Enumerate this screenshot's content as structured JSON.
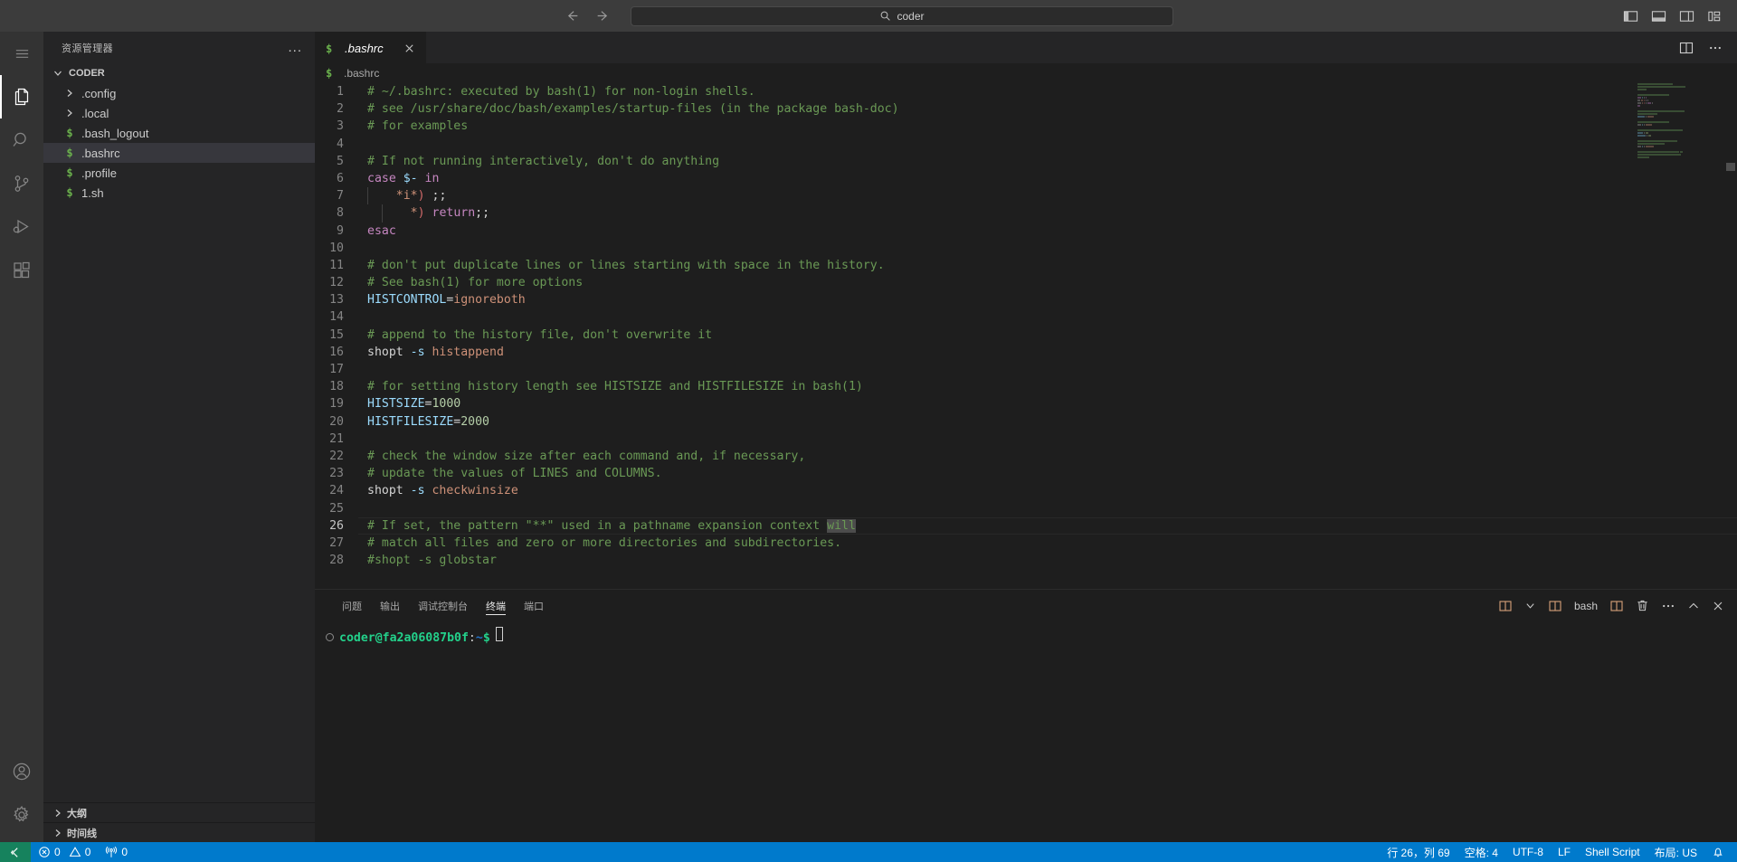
{
  "titlebar": {
    "back_icon": "arrow-left-icon",
    "forward_icon": "arrow-right-icon",
    "search": {
      "value": "coder",
      "placeholder": "",
      "icon": "search-icon"
    },
    "layout_icons": [
      "toggle-primary-sidebar-icon",
      "toggle-panel-icon",
      "toggle-secondary-sidebar-icon",
      "customize-layout-icon"
    ]
  },
  "activitybar": {
    "menu_icon": "hamburger-menu-icon",
    "items": [
      {
        "name": "explorer",
        "icon": "files-icon",
        "active": true
      },
      {
        "name": "search",
        "icon": "search-icon",
        "active": false
      },
      {
        "name": "source-control",
        "icon": "source-control-icon",
        "active": false
      },
      {
        "name": "run-and-debug",
        "icon": "run-debug-icon",
        "active": false
      },
      {
        "name": "extensions",
        "icon": "extensions-icon",
        "active": false
      }
    ],
    "bottom_items": [
      {
        "name": "accounts",
        "icon": "account-icon"
      },
      {
        "name": "manage",
        "icon": "gear-icon"
      }
    ]
  },
  "sidebar": {
    "title": "资源管理器",
    "more_actions": "...",
    "root_folder": "CODER",
    "tree": [
      {
        "label": ".config",
        "type": "folder",
        "icon": "chevron-right-icon",
        "selected": false
      },
      {
        "label": ".local",
        "type": "folder",
        "icon": "chevron-right-icon",
        "selected": false
      },
      {
        "label": ".bash_logout",
        "type": "file",
        "icon": "shell-file-icon",
        "selected": false
      },
      {
        "label": ".bashrc",
        "type": "file",
        "icon": "shell-file-icon",
        "selected": true
      },
      {
        "label": ".profile",
        "type": "file",
        "icon": "shell-file-icon",
        "selected": false
      },
      {
        "label": "1.sh",
        "type": "file",
        "icon": "shell-file-icon",
        "selected": false
      }
    ],
    "bottom_sections": [
      {
        "label": "大纲",
        "icon": "chevron-right-icon"
      },
      {
        "label": "时间线",
        "icon": "chevron-right-icon"
      }
    ]
  },
  "editor": {
    "tab": {
      "label": ".bashrc",
      "icon": "shell-file-icon",
      "close_icon": "close-icon",
      "dirty": false,
      "preview": true
    },
    "actions": [
      "split-editor-icon",
      "more-actions-icon"
    ],
    "breadcrumb": {
      "label": ".bashrc",
      "icon": "shell-file-icon"
    },
    "lines": [
      {
        "n": "1",
        "segs": [
          {
            "t": "# ~/.bashrc: executed by bash(1) for non-login shells.",
            "c": "cm"
          }
        ]
      },
      {
        "n": "2",
        "segs": [
          {
            "t": "# see /usr/share/doc/bash/examples/startup-files (in the package bash-doc)",
            "c": "cm"
          }
        ]
      },
      {
        "n": "3",
        "segs": [
          {
            "t": "# for examples",
            "c": "cm"
          }
        ]
      },
      {
        "n": "4",
        "segs": []
      },
      {
        "n": "5",
        "segs": [
          {
            "t": "# If not running interactively, don't do anything",
            "c": "cm"
          }
        ]
      },
      {
        "n": "6",
        "segs": [
          {
            "t": "case ",
            "c": "kw"
          },
          {
            "t": "$-",
            "c": "var"
          },
          {
            "t": " ",
            "c": "op"
          },
          {
            "t": "in",
            "c": "kw"
          }
        ]
      },
      {
        "n": "7",
        "segs": [
          {
            "t": "    ",
            "c": "op"
          },
          {
            "t": "*i*",
            "c": "pat"
          },
          {
            "t": ")",
            "c": "red"
          },
          {
            "t": " ",
            "c": "op"
          },
          {
            "t": ";;",
            "c": "op"
          }
        ]
      },
      {
        "n": "8",
        "segs": [
          {
            "t": "      ",
            "c": "op"
          },
          {
            "t": "*",
            "c": "pat"
          },
          {
            "t": ")",
            "c": "red"
          },
          {
            "t": " ",
            "c": "op"
          },
          {
            "t": "return",
            "c": "kw"
          },
          {
            "t": ";;",
            "c": "op"
          }
        ]
      },
      {
        "n": "9",
        "segs": [
          {
            "t": "esac",
            "c": "kw"
          }
        ]
      },
      {
        "n": "10",
        "segs": []
      },
      {
        "n": "11",
        "segs": [
          {
            "t": "# don't put duplicate lines or lines starting with space in the history.",
            "c": "cm"
          }
        ]
      },
      {
        "n": "12",
        "segs": [
          {
            "t": "# See bash(1) for more options",
            "c": "cm"
          }
        ]
      },
      {
        "n": "13",
        "segs": [
          {
            "t": "HISTCONTROL",
            "c": "var"
          },
          {
            "t": "=",
            "c": "op"
          },
          {
            "t": "ignoreboth",
            "c": "str"
          }
        ]
      },
      {
        "n": "14",
        "segs": []
      },
      {
        "n": "15",
        "segs": [
          {
            "t": "# append to the history file, don't overwrite it",
            "c": "cm"
          }
        ]
      },
      {
        "n": "16",
        "segs": [
          {
            "t": "shopt ",
            "c": "op"
          },
          {
            "t": "-s",
            "c": "var"
          },
          {
            "t": " ",
            "c": "op"
          },
          {
            "t": "histappend",
            "c": "str"
          }
        ]
      },
      {
        "n": "17",
        "segs": []
      },
      {
        "n": "18",
        "segs": [
          {
            "t": "# for setting history length see HISTSIZE and HISTFILESIZE in bash(1)",
            "c": "cm"
          }
        ]
      },
      {
        "n": "19",
        "segs": [
          {
            "t": "HISTSIZE",
            "c": "var"
          },
          {
            "t": "=",
            "c": "op"
          },
          {
            "t": "1000",
            "c": "num"
          }
        ]
      },
      {
        "n": "20",
        "segs": [
          {
            "t": "HISTFILESIZE",
            "c": "var"
          },
          {
            "t": "=",
            "c": "op"
          },
          {
            "t": "2000",
            "c": "num"
          }
        ]
      },
      {
        "n": "21",
        "segs": []
      },
      {
        "n": "22",
        "segs": [
          {
            "t": "# check the window size after each command and, if necessary,",
            "c": "cm"
          }
        ]
      },
      {
        "n": "23",
        "segs": [
          {
            "t": "# update the values of LINES and COLUMNS.",
            "c": "cm"
          }
        ]
      },
      {
        "n": "24",
        "segs": [
          {
            "t": "shopt ",
            "c": "op"
          },
          {
            "t": "-s",
            "c": "var"
          },
          {
            "t": " ",
            "c": "op"
          },
          {
            "t": "checkwinsize",
            "c": "str"
          }
        ]
      },
      {
        "n": "25",
        "segs": []
      },
      {
        "n": "26",
        "segs": [
          {
            "t": "# If set, the pattern \"**\" used in a pathname expansion context ",
            "c": "cm"
          },
          {
            "t": "will",
            "c": "cm sel"
          }
        ],
        "active": true
      },
      {
        "n": "27",
        "segs": [
          {
            "t": "# match all files and zero or more directories and subdirectories.",
            "c": "cm"
          }
        ]
      },
      {
        "n": "28",
        "segs": [
          {
            "t": "#shopt -s globstar",
            "c": "cm"
          }
        ]
      }
    ]
  },
  "panel": {
    "tabs": [
      {
        "label": "问题",
        "active": false
      },
      {
        "label": "输出",
        "active": false
      },
      {
        "label": "调试控制台",
        "active": false
      },
      {
        "label": "终端",
        "active": true
      },
      {
        "label": "端口",
        "active": false
      }
    ],
    "actions": {
      "new_terminal_icon": "split-terminal-icon",
      "dropdown_icon": "chevron-down-icon",
      "shell_icon": "terminal-icon",
      "shell_label": "bash",
      "split_icon": "split-icon",
      "kill_icon": "trash-icon",
      "more_icon": "more-actions-icon",
      "maximize_icon": "chevron-up-icon",
      "close_icon": "close-icon"
    },
    "terminal": {
      "user_host": "coder@fa2a06087b0f",
      "colon": ":",
      "path": "~",
      "dollar": "$"
    }
  },
  "statusbar": {
    "remote_icon": "remote-window-icon",
    "errors_icon": "error-icon",
    "errors": "0",
    "warnings_icon": "warning-icon",
    "warnings": "0",
    "ports_icon": "radio-tower-icon",
    "ports": "0",
    "cursor_position": "行 26，列 69",
    "indentation": "空格: 4",
    "encoding": "UTF-8",
    "eol": "LF",
    "language": "Shell Script",
    "keyboard_layout": "布局: US",
    "bell_icon": "bell-icon"
  }
}
